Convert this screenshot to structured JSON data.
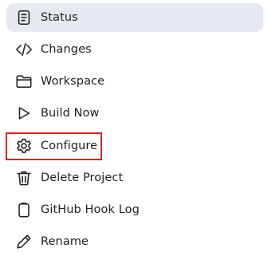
{
  "sidebar": {
    "items": [
      {
        "label": "Status",
        "icon": "document-icon",
        "active": true
      },
      {
        "label": "Changes",
        "icon": "code-icon"
      },
      {
        "label": "Workspace",
        "icon": "folder-icon"
      },
      {
        "label": "Build Now",
        "icon": "play-icon"
      },
      {
        "label": "Configure",
        "icon": "gear-icon",
        "highlighted": true
      },
      {
        "label": "Delete Project",
        "icon": "trash-icon"
      },
      {
        "label": "GitHub Hook Log",
        "icon": "clipboard-icon"
      },
      {
        "label": "Rename",
        "icon": "pencil-icon"
      }
    ]
  },
  "colors": {
    "active_background": "#e6e9ef",
    "highlight_border": "#e02020",
    "text": "#1d2021"
  }
}
